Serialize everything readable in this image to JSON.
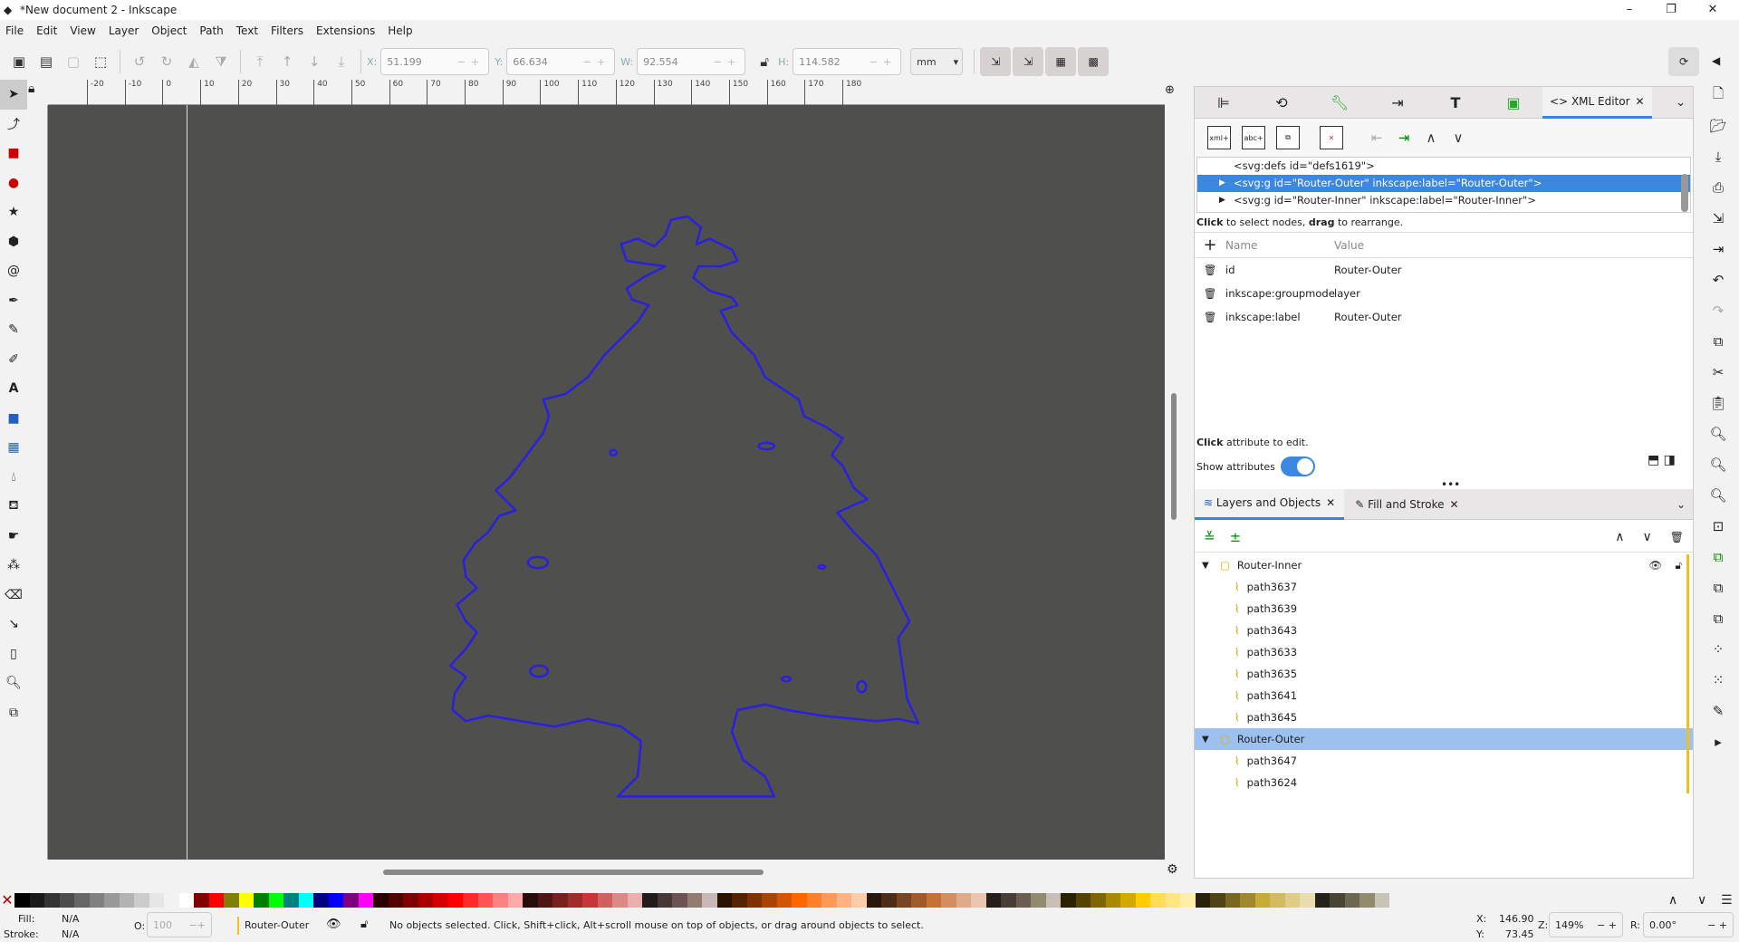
{
  "window": {
    "title": "*New document 2 - Inkscape",
    "minimize": "–",
    "maximize": "❐",
    "close": "✕"
  },
  "menu": [
    "File",
    "Edit",
    "View",
    "Layer",
    "Object",
    "Path",
    "Text",
    "Filters",
    "Extensions",
    "Help"
  ],
  "toolbar": {
    "x_label": "X:",
    "x": "51.199",
    "y_label": "Y:",
    "y": "66.634",
    "w_label": "W:",
    "w": "92.554",
    "h_label": "H:",
    "h": "114.582",
    "unit": "mm"
  },
  "ruler_ticks": [
    "-20",
    "-10",
    "0",
    "10",
    "20",
    "30",
    "40",
    "50",
    "60",
    "70",
    "80",
    "90",
    "100",
    "110",
    "120",
    "130",
    "140",
    "150",
    "160",
    "170",
    "180"
  ],
  "xml_editor": {
    "panel_tabs": [
      "align-icon",
      "transform-icon",
      "preferences-icon",
      "export-icon",
      "text-icon",
      "image-icon"
    ],
    "tab_label": "XML Editor",
    "nodes": [
      {
        "text": "<svg:defs id=\"defs1619\">",
        "expandable": false,
        "selected": false
      },
      {
        "text": "<svg:g id=\"Router-Outer\" inkscape:label=\"Router-Outer\">",
        "expandable": true,
        "selected": true
      },
      {
        "text": "<svg:g id=\"Router-Inner\" inkscape:label=\"Router-Inner\">",
        "expandable": true,
        "selected": false
      }
    ],
    "hint_bold1": "Click",
    "hint_mid": " to select nodes, ",
    "hint_bold2": "drag",
    "hint_end": " to rearrange.",
    "col_name": "Name",
    "col_value": "Value",
    "attributes": [
      {
        "name": "id",
        "value": "Router-Outer"
      },
      {
        "name": "inkscape:groupmode",
        "value": "layer"
      },
      {
        "name": "inkscape:label",
        "value": "Router-Outer"
      }
    ],
    "attr_hint_bold": "Click",
    "attr_hint": " attribute to edit.",
    "show_attributes": "Show attributes",
    "show_attributes_on": true
  },
  "layers": {
    "tab1": "Layers and Objects",
    "tab2": "Fill and Stroke",
    "tree": [
      {
        "label": "Router-Inner",
        "type": "layer",
        "level": 0,
        "selected": false
      },
      {
        "label": "path3637",
        "type": "path",
        "level": 1
      },
      {
        "label": "path3639",
        "type": "path",
        "level": 1
      },
      {
        "label": "path3643",
        "type": "path",
        "level": 1
      },
      {
        "label": "path3633",
        "type": "path",
        "level": 1
      },
      {
        "label": "path3635",
        "type": "path",
        "level": 1
      },
      {
        "label": "path3641",
        "type": "path",
        "level": 1
      },
      {
        "label": "path3645",
        "type": "path",
        "level": 1
      },
      {
        "label": "Router-Outer",
        "type": "layer",
        "level": 0,
        "selected": true
      },
      {
        "label": "path3647",
        "type": "path",
        "level": 1
      },
      {
        "label": "path3624",
        "type": "path",
        "level": 1
      }
    ]
  },
  "palette": [
    "#000000",
    "#1a1a1a",
    "#333333",
    "#4d4d4d",
    "#666666",
    "#808080",
    "#999999",
    "#b3b3b3",
    "#cccccc",
    "#e6e6e6",
    "#f2f2f2",
    "#ffffff",
    "#800000",
    "#ff0000",
    "#808000",
    "#ffff00",
    "#008000",
    "#00ff00",
    "#008080",
    "#00ffff",
    "#000080",
    "#0000ff",
    "#800080",
    "#ff00ff",
    "#2b0000",
    "#550000",
    "#800000",
    "#aa0000",
    "#d40000",
    "#ff0000",
    "#ff2a2a",
    "#ff5555",
    "#ff8080",
    "#ffaaaa",
    "#280b0b",
    "#501616",
    "#782121",
    "#a02c2c",
    "#c83737",
    "#d35f5f",
    "#de8787",
    "#e9afaf",
    "#241c1c",
    "#483737",
    "#6c5353",
    "#917c6f",
    "#c8b7b7",
    "#2b1100",
    "#552200",
    "#803300",
    "#aa4400",
    "#d45500",
    "#ff6600",
    "#ff7f2a",
    "#ff9955",
    "#ffb380",
    "#ffccaa",
    "#28170b",
    "#502d16",
    "#784421",
    "#a05a2c",
    "#c87137",
    "#d38d5f",
    "#deaa87",
    "#e9c6af",
    "#241f1c",
    "#483e37",
    "#6c5d53",
    "#918a6f",
    "#c8beb7",
    "#2b2200",
    "#554400",
    "#806600",
    "#aa8800",
    "#d4aa00",
    "#ffcc00",
    "#ffdd55",
    "#ffe680",
    "#ffeeaa",
    "#28220b",
    "#504416",
    "#786721",
    "#a0892c",
    "#c8ab37",
    "#d3bc5f",
    "#decd87",
    "#e9ddaf",
    "#24221c",
    "#484537",
    "#6c6753",
    "#918a6f",
    "#c8c4b7"
  ],
  "status": {
    "fill_label": "Fill:",
    "fill": "N/A",
    "stroke_label": "Stroke:",
    "stroke": "N/A",
    "opacity_label": "O:",
    "opacity": "100",
    "layer": "Router-Outer",
    "message": "No objects selected. Click, Shift+click, Alt+scroll mouse on top of objects, or drag around objects to select.",
    "x_label": "X:",
    "x": "146.90",
    "y_label": "Y:",
    "y": "73.45",
    "zoom_label": "Z:",
    "zoom": "149%",
    "rot_label": "R:",
    "rotation": "0.00°"
  },
  "colors": {
    "accent": "#3c87e0",
    "path_stroke": "#2a1fe0",
    "canvas": "#4f504e"
  }
}
